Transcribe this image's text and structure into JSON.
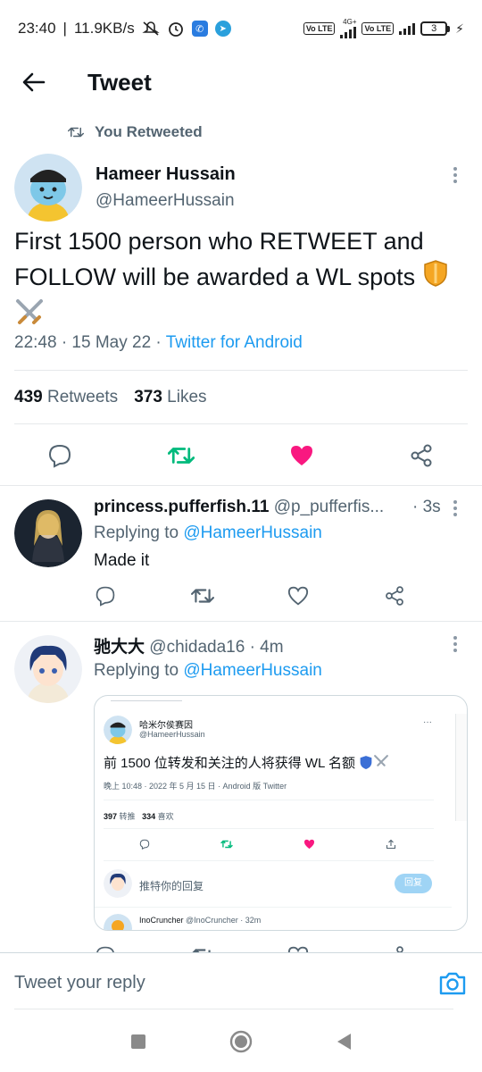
{
  "status_bar": {
    "time": "23:40",
    "speed": "11.9KB/s",
    "net_small": "4G+",
    "lte1": "Vo LTE",
    "lte2": "Vo LTE",
    "battery": "3"
  },
  "header": {
    "title": "Tweet"
  },
  "retweet_label": "You Retweeted",
  "main_tweet": {
    "author_name": "Hameer Hussain",
    "author_handle": "@HameerHussain",
    "text": "First 1500 person who RETWEET and FOLLOW will be awarded a WL spots",
    "emojis": [
      "shield-icon",
      "crossed-swords-icon"
    ],
    "time": "22:48 · 15 May 22 · ",
    "source": "Twitter for Android",
    "retweets_count": "439",
    "retweets_label": "Retweets",
    "likes_count": "373",
    "likes_label": "Likes",
    "liked": true,
    "retweeted": true,
    "colors": {
      "retweet": "#00ba7c",
      "like": "#f91880",
      "link": "#1d9bf0"
    }
  },
  "replies": [
    {
      "name": "princess.pufferfish.11",
      "handle": "@p_pufferfis...",
      "time": "· 3s",
      "replying_prefix": "Replying to ",
      "replying_to": "@HameerHussain",
      "text": "Made it"
    },
    {
      "name": "驰大大",
      "handle": "@chidada16",
      "time": "· 4m",
      "replying_prefix": "Replying to ",
      "replying_to": "@HameerHussain",
      "embed": {
        "name": "哈米尔侯赛因",
        "handle": "@HameerHussain",
        "text": "前 1500 位转发和关注的人将获得 WL 名额",
        "meta": "晚上 10:48 · 2022 年 5 月 15 日 · Android 版 Twitter",
        "retweets": "397",
        "retweets_label": "转推",
        "likes": "334",
        "likes_label": "喜欢",
        "reply_placeholder": "推特你的回复",
        "reply_button": "回复",
        "next_name": "InoCruncher",
        "next_handle": "@InoCruncher · 32m"
      }
    }
  ],
  "reply_bar": {
    "placeholder": "Tweet your reply"
  }
}
